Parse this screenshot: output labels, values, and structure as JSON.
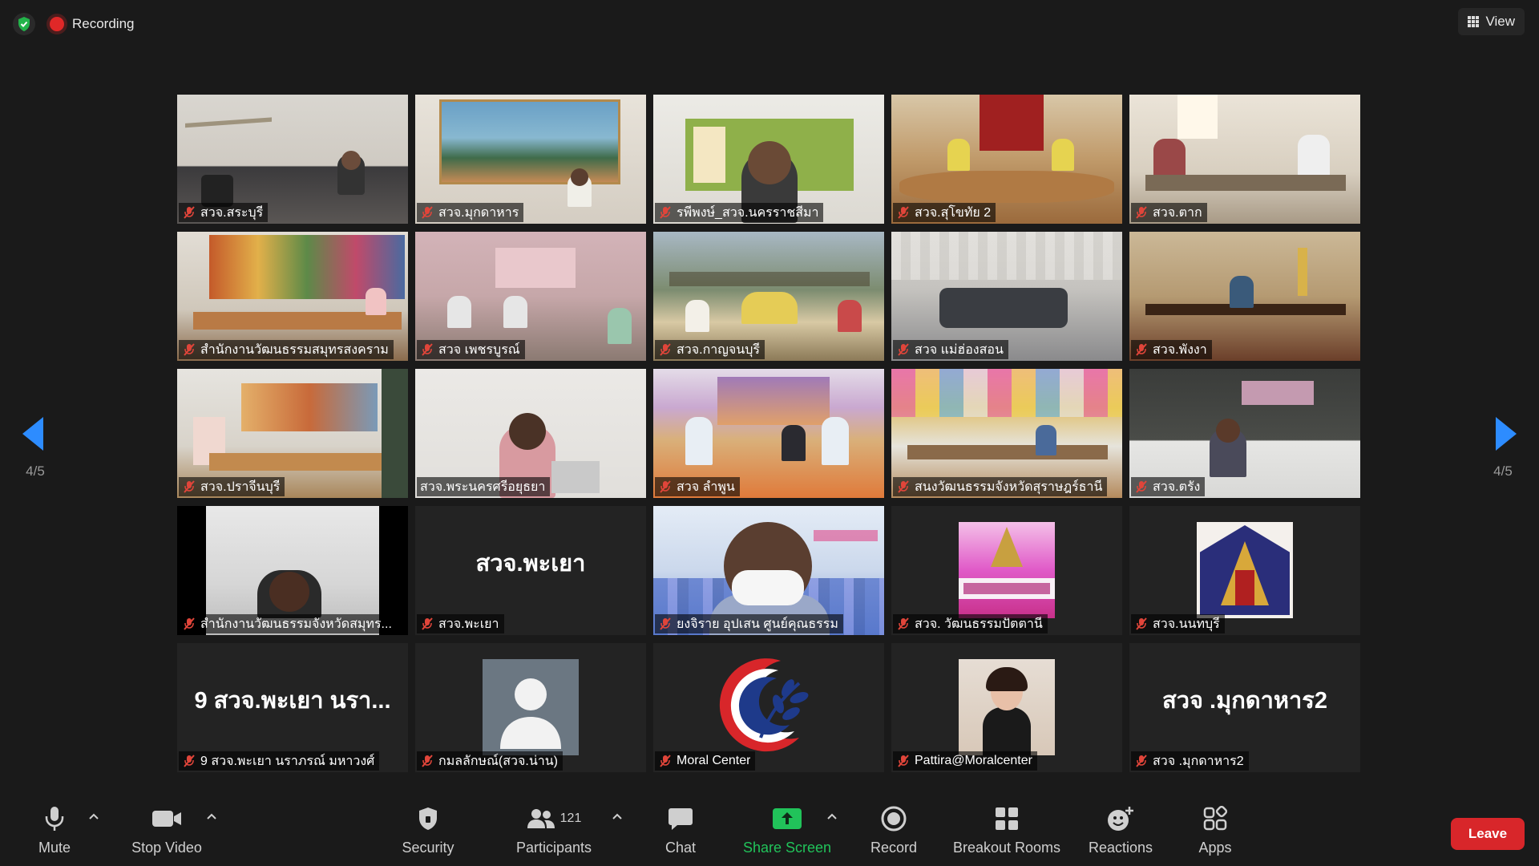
{
  "topbar": {
    "recording_label": "Recording",
    "view_label": "View"
  },
  "pagination": {
    "left_indicator": "4/5",
    "right_indicator": "4/5"
  },
  "tiles": [
    {
      "name": "สวจ.สระบุรี",
      "muted": true
    },
    {
      "name": "สวจ.มุกดาหาร",
      "muted": true
    },
    {
      "name": "รพีพงษ์_สวจ.นครราชสีมา",
      "muted": true
    },
    {
      "name": "สวจ.สุโขทัย 2",
      "muted": true
    },
    {
      "name": "สวจ.ตาก",
      "muted": true
    },
    {
      "name": "สำนักงานวัฒนธรรมสมุทรสงคราม",
      "muted": true
    },
    {
      "name": "สวจ เพชรบูรณ์",
      "muted": true
    },
    {
      "name": "สวจ.กาญจนบุรี",
      "muted": true
    },
    {
      "name": "สวจ แม่ฮ่องสอน",
      "muted": true
    },
    {
      "name": "สวจ.พังงา",
      "muted": true
    },
    {
      "name": "สวจ.ปราจีนบุรี",
      "muted": true
    },
    {
      "name": "สวจ.พระนครศรีอยุธยา",
      "muted": false
    },
    {
      "name": "สวจ ลำพูน",
      "muted": true
    },
    {
      "name": "สนงวัฒนธรรมจังหวัดสุราษฎร์ธานี",
      "muted": true
    },
    {
      "name": "สวจ.ตรัง",
      "muted": true
    },
    {
      "name": "สำนักงานวัฒนธรรมจังหวัดสมุทร...",
      "muted": true
    },
    {
      "name": "สวจ.พะเยา",
      "muted": true,
      "display_name": "สวจ.พะเยา"
    },
    {
      "name": "ยงจิราย  อุปเสน ศูนย์คุณธรรม",
      "muted": true
    },
    {
      "name": "สวจ. วัฒนธรรมปัตตานี",
      "muted": true
    },
    {
      "name": "สวจ.นนทบุรี",
      "muted": true
    },
    {
      "name": "9 สวจ.พะเยา นราภรณ์ มหาวงศ์",
      "muted": true,
      "display_name": "9 สวจ.พะเยา นรา..."
    },
    {
      "name": "กมลลักษณ์(สวจ.น่าน)",
      "muted": true
    },
    {
      "name": "Moral Center",
      "muted": true
    },
    {
      "name": "Pattira@Moralcenter",
      "muted": true
    },
    {
      "name": "สวจ .มุกดาหาร2",
      "muted": true,
      "display_name": "สวจ .มุกดาหาร2"
    }
  ],
  "toolbar": {
    "mute_label": "Mute",
    "stop_video_label": "Stop Video",
    "security_label": "Security",
    "participants_label": "Participants",
    "participants_count": "121",
    "chat_label": "Chat",
    "share_screen_label": "Share Screen",
    "record_label": "Record",
    "breakout_rooms_label": "Breakout Rooms",
    "reactions_label": "Reactions",
    "apps_label": "Apps",
    "leave_label": "Leave"
  },
  "colors": {
    "background": "#1a1a1a",
    "recording_red": "#e02828",
    "share_green": "#21c35a",
    "leave_red": "#d8262a",
    "mic_off_red": "#e0453a",
    "arrow_blue": "#2d8cff"
  }
}
